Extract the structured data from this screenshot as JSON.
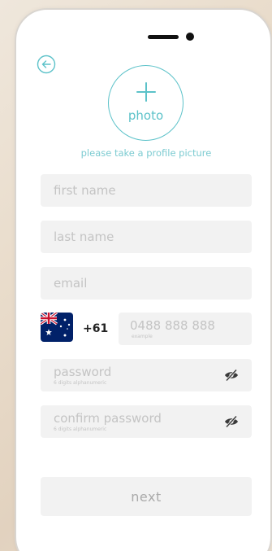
{
  "status_bar": {
    "pill_icon": "notch-pill",
    "camera_icon": "camera-dot"
  },
  "header": {
    "back_icon": "arrow-left-circle-icon"
  },
  "photo": {
    "icon": "plus-icon",
    "label": "photo",
    "hint": "please take a profile picture"
  },
  "form": {
    "first_name": {
      "placeholder": "first name",
      "value": ""
    },
    "last_name": {
      "placeholder": "last name",
      "value": ""
    },
    "email": {
      "placeholder": "email",
      "value": ""
    },
    "phone": {
      "flag_icon": "australia-flag-icon",
      "dial_code": "+61",
      "placeholder": "0488 888 888",
      "example": "example",
      "value": ""
    },
    "password": {
      "placeholder": "password",
      "hint": "6 digits alphanumeric",
      "eye_icon": "eye-slash-icon",
      "value": ""
    },
    "confirm_password": {
      "placeholder": "confirm password",
      "hint": "6 digits alphanumeric",
      "eye_icon": "eye-slash-icon",
      "value": ""
    }
  },
  "actions": {
    "next_label": "next"
  },
  "colors": {
    "accent": "#5cc2c9",
    "field_bg": "#f2f2f2",
    "placeholder": "#c4c4c4",
    "button_text": "#a9a9a9"
  }
}
